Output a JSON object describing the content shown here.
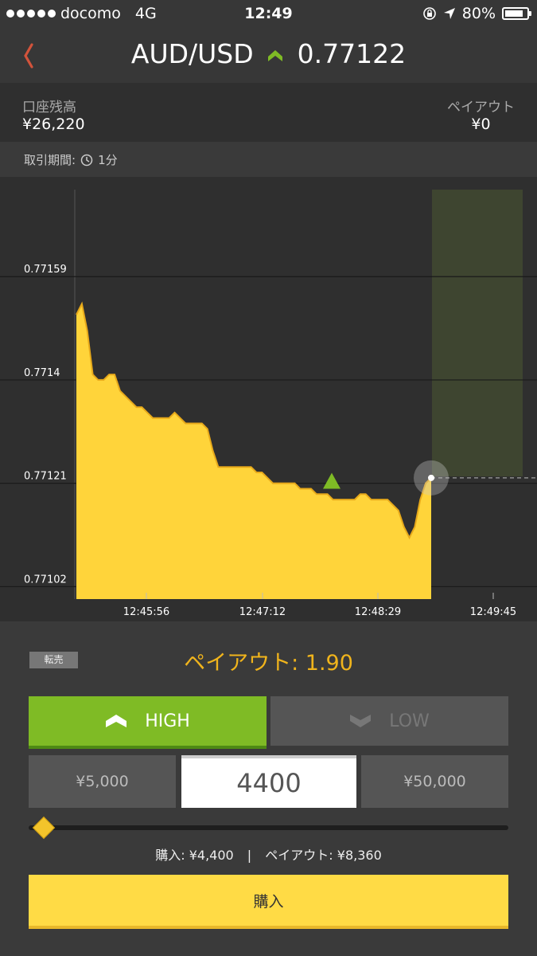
{
  "status": {
    "carrier": "docomo",
    "network": "4G",
    "time": "12:49",
    "battery": "80%"
  },
  "header": {
    "pair": "AUD/USD",
    "rate": "0.77122",
    "direction_icon": "up-chevron-icon",
    "accent": "#7fbb25"
  },
  "account": {
    "balance_label": "口座残高",
    "balance_value": "¥26,220",
    "payout_label": "ペイアウト",
    "payout_value": "¥0"
  },
  "period": {
    "label": "取引期間:",
    "value": "1分"
  },
  "chart_data": {
    "type": "area",
    "y_ticks": [
      "0.77159",
      "0.7714",
      "0.77121",
      "0.77102"
    ],
    "x_ticks": [
      "12:45:56",
      "12:47:12",
      "12:48:29",
      "12:49:45"
    ],
    "ylim": [
      0.771,
      0.77175
    ],
    "series": [
      {
        "values": [
          0.77152,
          0.77154,
          0.77149,
          0.77141,
          0.7714,
          0.7714,
          0.77141,
          0.77141,
          0.77138,
          0.77137,
          0.77136,
          0.77135,
          0.77135,
          0.77134,
          0.77133,
          0.77133,
          0.77133,
          0.77133,
          0.77134,
          0.77133,
          0.77132,
          0.77132,
          0.77132,
          0.77132,
          0.77131,
          0.77127,
          0.77124,
          0.77124,
          0.77124,
          0.77124,
          0.77124,
          0.77124,
          0.77124,
          0.77123,
          0.77123,
          0.77122,
          0.77121,
          0.77121,
          0.77121,
          0.77121,
          0.77121,
          0.7712,
          0.7712,
          0.7712,
          0.77119,
          0.77119,
          0.77119,
          0.77118,
          0.77118,
          0.77118,
          0.77118,
          0.77118,
          0.77119,
          0.77119,
          0.77118,
          0.77118,
          0.77118,
          0.77118,
          0.77117,
          0.77116,
          0.77113,
          0.77111,
          0.77113,
          0.77118,
          0.77121,
          0.77122
        ]
      }
    ],
    "area_color": "#ffd43a",
    "current_value": "0.77122",
    "entry_marker_color": "#7fbb25",
    "expiry_zone_color": "#3e4530"
  },
  "controls": {
    "resell_label": "転売",
    "payout_rate": "ペイアウト: 1.90",
    "high_label": "HIGH",
    "low_label": "LOW",
    "amount_min": "¥5,000",
    "amount_value": "4400",
    "amount_max": "¥50,000",
    "slider_fraction": 0.0,
    "summary_buy": "購入: ¥4,400",
    "summary_sep": "|",
    "summary_payout": "ペイアウト: ¥8,360",
    "buy_label": "購入"
  }
}
